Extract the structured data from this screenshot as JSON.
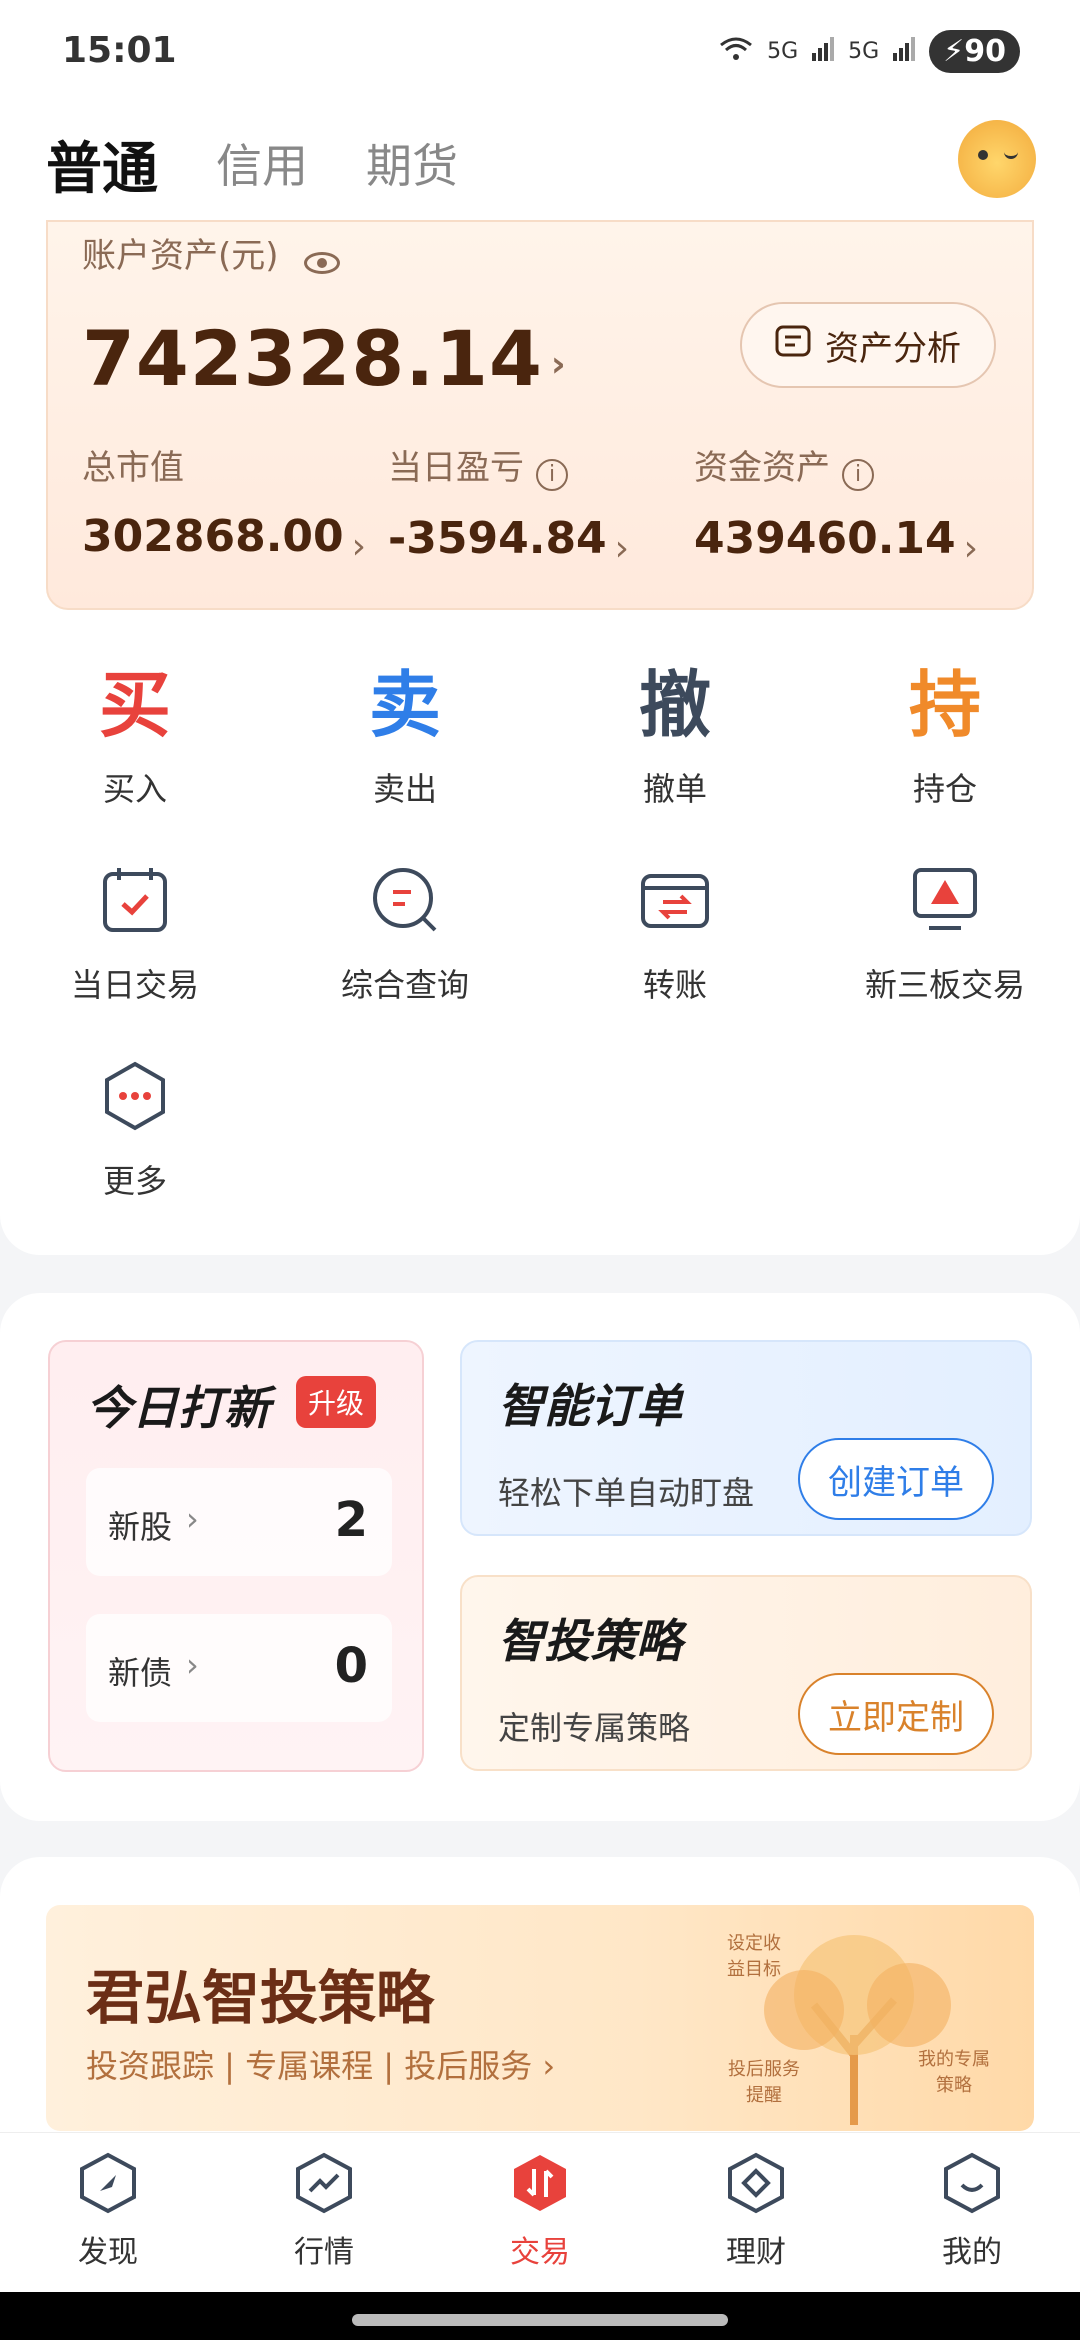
{
  "status_bar": {
    "time": "15:01",
    "net1": "5G",
    "net2": "5G",
    "battery": "90"
  },
  "top_tabs": [
    {
      "label": "普通"
    },
    {
      "label": "信用"
    },
    {
      "label": "期货"
    }
  ],
  "asset": {
    "label": "账户资产(元)",
    "total": "742328.14",
    "analysis_label": "资产分析",
    "metrics": [
      {
        "label": "总市值",
        "value": "302868.00"
      },
      {
        "label": "当日盈亏",
        "value": "-3594.84"
      },
      {
        "label": "资金资产",
        "value": "439460.14"
      }
    ]
  },
  "quick_actions": [
    {
      "glyph": "买",
      "label": "买入",
      "color": "#e8423c"
    },
    {
      "glyph": "卖",
      "label": "卖出",
      "color": "#2f7ee8"
    },
    {
      "glyph": "撤",
      "label": "撤单",
      "color": "#3d4a5c"
    },
    {
      "glyph": "持",
      "label": "持仓",
      "color": "#f08a2a"
    }
  ],
  "functions": [
    {
      "label": "当日交易"
    },
    {
      "label": "综合查询"
    },
    {
      "label": "转账"
    },
    {
      "label": "新三板交易"
    },
    {
      "label": "更多"
    }
  ],
  "ipo": {
    "title": "今日打新",
    "badge": "升级",
    "rows": [
      {
        "label": "新股",
        "count": "2"
      },
      {
        "label": "新债",
        "count": "0"
      }
    ]
  },
  "smart_order": {
    "title": "智能订单",
    "subtitle": "轻松下单自动盯盘",
    "button": "创建订单",
    "accent": "#2f7ee8"
  },
  "strategy": {
    "title": "智投策略",
    "subtitle": "定制专属策略",
    "button": "立即定制",
    "accent": "#d9822b"
  },
  "banner": {
    "title": "君弘智投策略",
    "subtitle": "投资跟踪 | 专属课程 | 投后服务 ›",
    "tags": [
      "设定收益目标",
      "投后服务提醒",
      "我的专属策略"
    ]
  },
  "bottom_nav": [
    {
      "label": "发现",
      "icon": "compass-icon"
    },
    {
      "label": "行情",
      "icon": "trend-icon"
    },
    {
      "label": "交易",
      "icon": "trade-icon"
    },
    {
      "label": "理财",
      "icon": "finance-icon"
    },
    {
      "label": "我的",
      "icon": "profile-icon"
    }
  ]
}
